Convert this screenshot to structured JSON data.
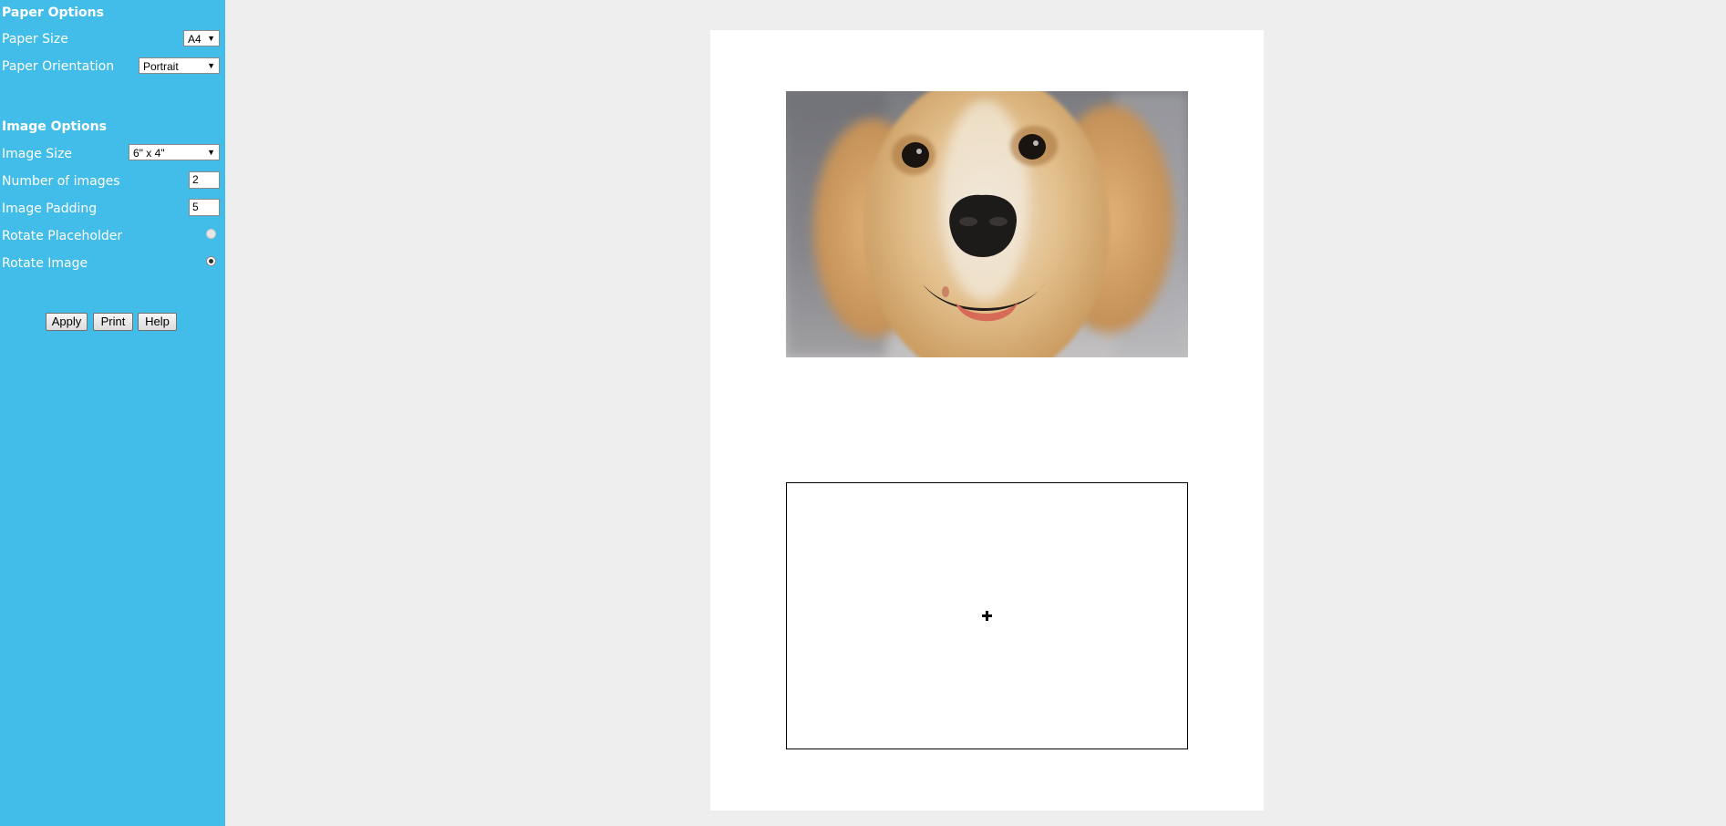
{
  "sidebar": {
    "paper_options": {
      "title": "Paper Options",
      "paper_size_label": "Paper Size",
      "paper_size_value": "A4",
      "paper_orientation_label": "Paper Orientation",
      "paper_orientation_value": "Portrait"
    },
    "image_options": {
      "title": "Image Options",
      "image_size_label": "Image Size",
      "image_size_value": "6\" x 4\"",
      "num_images_label": "Number of images",
      "num_images_value": "2",
      "padding_label": "Image Padding",
      "padding_value": "5",
      "rotate_placeholder_label": "Rotate Placeholder",
      "rotate_placeholder_checked": false,
      "rotate_image_label": "Rotate Image",
      "rotate_image_checked": true
    },
    "buttons": {
      "apply": "Apply",
      "print": "Print",
      "help": "Help"
    }
  },
  "colors": {
    "sidebar_bg": "#42bce8",
    "canvas_bg": "#eeeeee",
    "paper_bg": "#ffffff"
  },
  "paper": {
    "slots": [
      {
        "type": "image",
        "content": "golden retriever puppy photo"
      },
      {
        "type": "placeholder",
        "icon": "plus-icon"
      }
    ]
  }
}
